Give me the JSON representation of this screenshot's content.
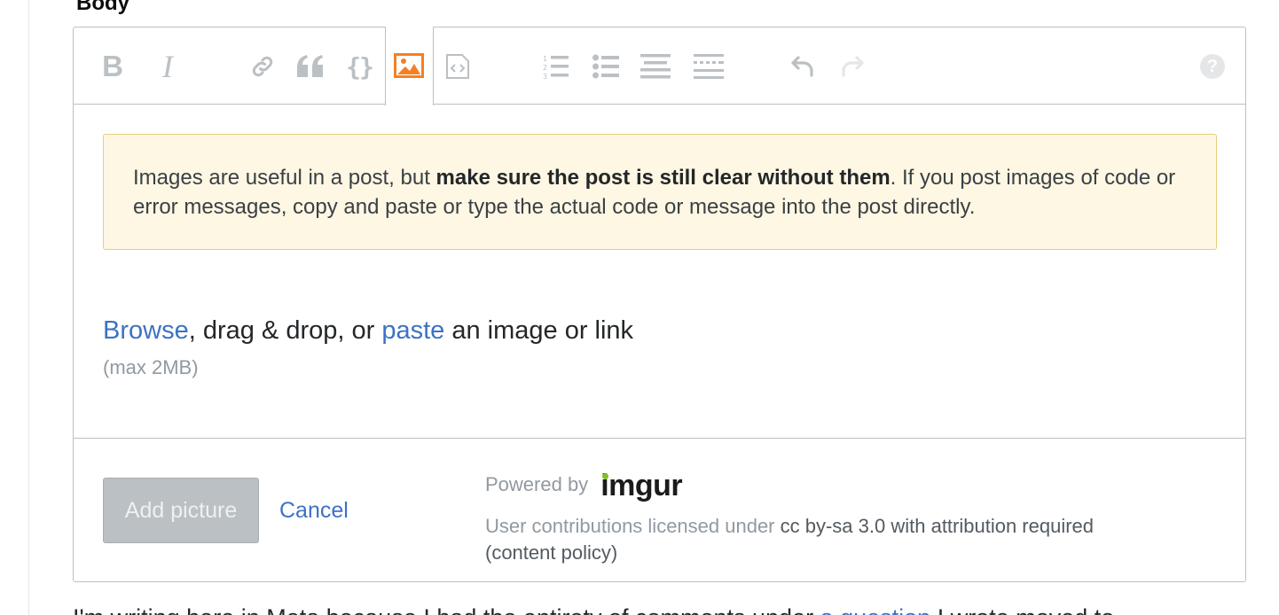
{
  "section": {
    "label": "Body"
  },
  "toolbar": {
    "buttons": [
      {
        "name": "bold",
        "glyph": "B"
      },
      {
        "name": "italic",
        "glyph": "I"
      },
      {
        "name": "link"
      },
      {
        "name": "blockquote"
      },
      {
        "name": "code"
      },
      {
        "name": "image",
        "active": true
      },
      {
        "name": "snippet"
      },
      {
        "name": "ordered-list"
      },
      {
        "name": "unordered-list"
      },
      {
        "name": "heading"
      },
      {
        "name": "horizontal-rule"
      },
      {
        "name": "undo"
      },
      {
        "name": "redo"
      },
      {
        "name": "help"
      }
    ],
    "glyphs": {
      "bold": "B",
      "italic": "I",
      "code": "{}",
      "help": "?"
    }
  },
  "warning": {
    "text_before": "Images are useful in a post, but ",
    "text_bold": "make sure the post is still clear without them",
    "text_after": ". If you post images of code or error messages, copy and paste or type the actual code or message into the post directly."
  },
  "upload": {
    "browse_link": "Browse",
    "middle_text": ", drag & drop, or ",
    "paste_link": "paste",
    "end_text": " an image or link",
    "max_size": "(max 2MB)"
  },
  "footer": {
    "add_button": "Add picture",
    "cancel_link": "Cancel",
    "powered_by": "Powered by",
    "brand": "imgur",
    "license_prefix": "User contributions licensed under ",
    "license_name": "cc by-sa 3.0 with attribution required",
    "content_policy": "(content policy)"
  },
  "below": {
    "text_before": "I'm writing here in Meta because I had the entirety of comments under ",
    "link": "a question",
    "text_after": " I wrote moved to"
  },
  "colors": {
    "accent": "#f48024",
    "link": "#3d72c5",
    "toolbar_icon": "#bbc0c4",
    "warning_bg": "#fdf7e3",
    "warning_border": "#e6cf79",
    "imgur_green": "#85bf25"
  }
}
